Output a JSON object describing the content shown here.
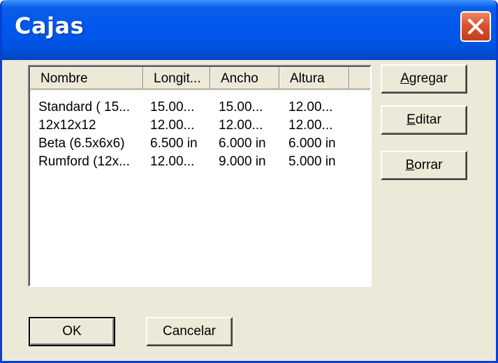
{
  "window": {
    "title": "Cajas"
  },
  "list": {
    "columns": [
      "Nombre",
      "Longit...",
      "Ancho",
      "Altura"
    ],
    "rows": [
      [
        "Standard ( 15...",
        "15.00...",
        "15.00...",
        "12.00..."
      ],
      [
        "12x12x12",
        "12.00...",
        "12.00...",
        "12.00..."
      ],
      [
        "Beta (6.5x6x6)",
        "6.500 in",
        "6.000 in",
        "6.000 in"
      ],
      [
        "Rumford (12x...",
        "12.00...",
        "9.000 in",
        "5.000 in"
      ]
    ]
  },
  "buttons": {
    "add": {
      "mnemonic": "A",
      "rest": "gregar"
    },
    "edit": {
      "mnemonic": "E",
      "rest": "ditar"
    },
    "delete": {
      "mnemonic": "B",
      "rest": "orrar"
    },
    "ok": "OK",
    "cancel": "Cancelar"
  },
  "colors": {
    "titlebar": "#0054e3",
    "dialog_bg": "#ece9d8",
    "close_button": "#d8532f"
  },
  "icons": {
    "close": "close-icon"
  }
}
